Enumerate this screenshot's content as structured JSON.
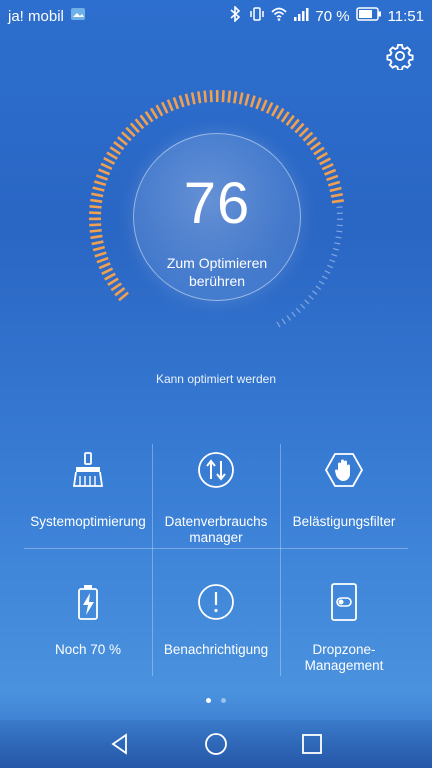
{
  "statusbar": {
    "carrier": "ja! mobil",
    "battery_percent": "70 %",
    "time": "11:51"
  },
  "gauge": {
    "score": "76",
    "action_label": "Zum Optimieren berühren",
    "status": "Kann optimiert werden"
  },
  "tiles": [
    {
      "label": "Systemoptimierung",
      "icon": "broom-icon"
    },
    {
      "label": "Datenverbrauchs manager",
      "icon": "data-transfer-icon"
    },
    {
      "label": "Belästigungsfilter",
      "icon": "hand-block-icon"
    },
    {
      "label": "Noch 70 %",
      "icon": "battery-icon"
    },
    {
      "label": "Benachrichtigung",
      "icon": "alert-icon"
    },
    {
      "label": "Dropzone-Management",
      "icon": "dropzone-icon"
    }
  ],
  "page_indicator": {
    "pages": 2,
    "active": 1
  },
  "colors": {
    "gauge_active": "#f0a050",
    "gauge_inactive": "#9bbbe6",
    "background": "#2d6fce"
  }
}
